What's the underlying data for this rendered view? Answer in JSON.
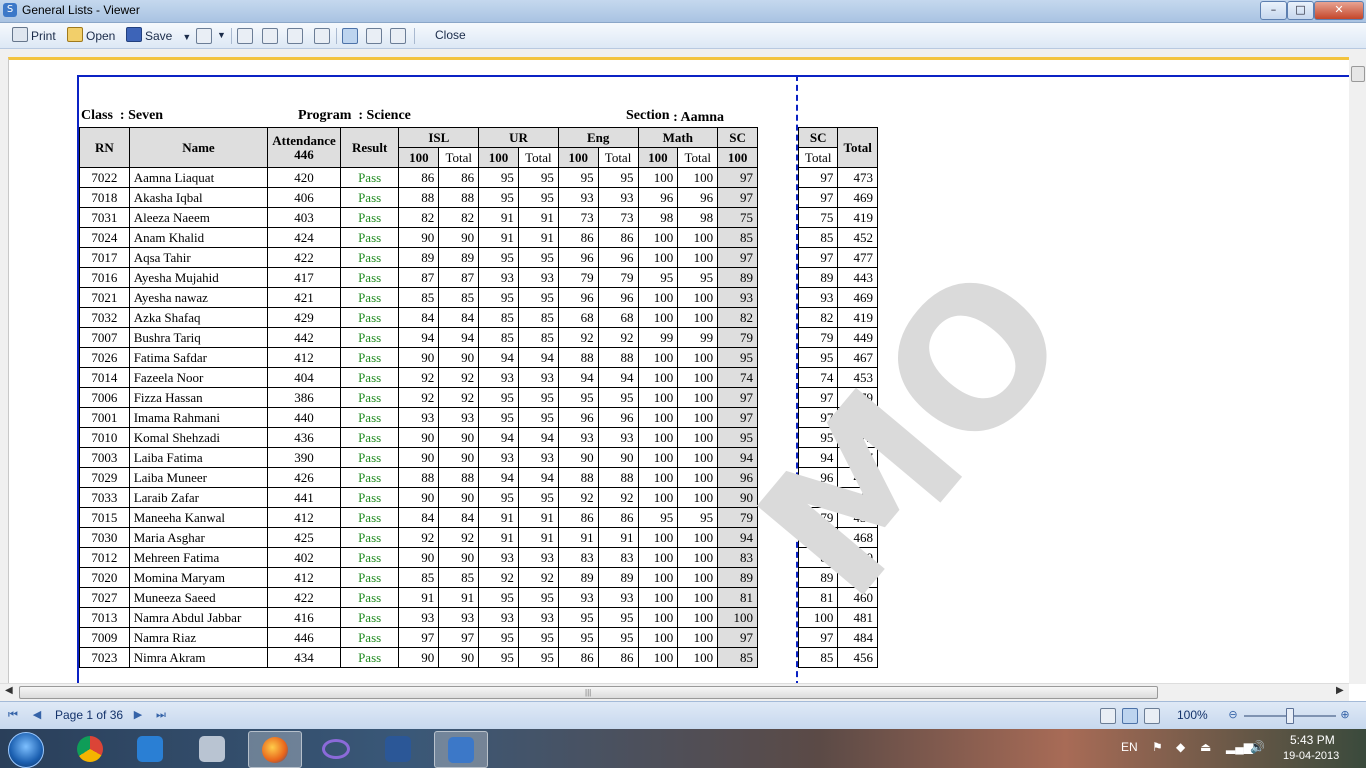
{
  "window": {
    "title": "General Lists - Viewer",
    "icon": "viewer-app-icon"
  },
  "toolbar": {
    "print_label": "Print",
    "open_label": "Open",
    "save_label": "Save",
    "close_label": "Close"
  },
  "report": {
    "class_label": "Class",
    "class_value": ": Seven",
    "program_label": "Program",
    "program_value": ": Science",
    "section_label": "Section",
    "section_value": ": Aamna",
    "headers": {
      "rn": "RN",
      "name": "Name",
      "attendance": "Attendance",
      "attendance_total": "446",
      "result": "Result",
      "isl": "ISL",
      "ur": "UR",
      "eng": "Eng",
      "math": "Math",
      "sc": "SC",
      "max": "100",
      "total": "Total",
      "sc_right": "SC",
      "sc_right_total": "Total",
      "grand_total": "Total"
    },
    "rows": [
      {
        "rn": "7022",
        "name": "Aamna Liaquat",
        "att": "420",
        "result": "Pass",
        "isl": "86",
        "isl_t": "86",
        "ur": "95",
        "ur_t": "95",
        "eng": "95",
        "eng_t": "95",
        "math": "100",
        "math_t": "100",
        "sc": "97",
        "sc_t": "97",
        "total": "473"
      },
      {
        "rn": "7018",
        "name": "Akasha Iqbal",
        "att": "406",
        "result": "Pass",
        "isl": "88",
        "isl_t": "88",
        "ur": "95",
        "ur_t": "95",
        "eng": "93",
        "eng_t": "93",
        "math": "96",
        "math_t": "96",
        "sc": "97",
        "sc_t": "97",
        "total": "469"
      },
      {
        "rn": "7031",
        "name": "Aleeza Naeem",
        "att": "403",
        "result": "Pass",
        "isl": "82",
        "isl_t": "82",
        "ur": "91",
        "ur_t": "91",
        "eng": "73",
        "eng_t": "73",
        "math": "98",
        "math_t": "98",
        "sc": "75",
        "sc_t": "75",
        "total": "419"
      },
      {
        "rn": "7024",
        "name": "Anam Khalid",
        "att": "424",
        "result": "Pass",
        "isl": "90",
        "isl_t": "90",
        "ur": "91",
        "ur_t": "91",
        "eng": "86",
        "eng_t": "86",
        "math": "100",
        "math_t": "100",
        "sc": "85",
        "sc_t": "85",
        "total": "452"
      },
      {
        "rn": "7017",
        "name": "Aqsa Tahir",
        "att": "422",
        "result": "Pass",
        "isl": "89",
        "isl_t": "89",
        "ur": "95",
        "ur_t": "95",
        "eng": "96",
        "eng_t": "96",
        "math": "100",
        "math_t": "100",
        "sc": "97",
        "sc_t": "97",
        "total": "477"
      },
      {
        "rn": "7016",
        "name": "Ayesha Mujahid",
        "att": "417",
        "result": "Pass",
        "isl": "87",
        "isl_t": "87",
        "ur": "93",
        "ur_t": "93",
        "eng": "79",
        "eng_t": "79",
        "math": "95",
        "math_t": "95",
        "sc": "89",
        "sc_t": "89",
        "total": "443"
      },
      {
        "rn": "7021",
        "name": "Ayesha nawaz",
        "att": "421",
        "result": "Pass",
        "isl": "85",
        "isl_t": "85",
        "ur": "95",
        "ur_t": "95",
        "eng": "96",
        "eng_t": "96",
        "math": "100",
        "math_t": "100",
        "sc": "93",
        "sc_t": "93",
        "total": "469"
      },
      {
        "rn": "7032",
        "name": "Azka Shafaq",
        "att": "429",
        "result": "Pass",
        "isl": "84",
        "isl_t": "84",
        "ur": "85",
        "ur_t": "85",
        "eng": "68",
        "eng_t": "68",
        "math": "100",
        "math_t": "100",
        "sc": "82",
        "sc_t": "82",
        "total": "419"
      },
      {
        "rn": "7007",
        "name": "Bushra Tariq",
        "att": "442",
        "result": "Pass",
        "isl": "94",
        "isl_t": "94",
        "ur": "85",
        "ur_t": "85",
        "eng": "92",
        "eng_t": "92",
        "math": "99",
        "math_t": "99",
        "sc": "79",
        "sc_t": "79",
        "total": "449"
      },
      {
        "rn": "7026",
        "name": "Fatima Safdar",
        "att": "412",
        "result": "Pass",
        "isl": "90",
        "isl_t": "90",
        "ur": "94",
        "ur_t": "94",
        "eng": "88",
        "eng_t": "88",
        "math": "100",
        "math_t": "100",
        "sc": "95",
        "sc_t": "95",
        "total": "467"
      },
      {
        "rn": "7014",
        "name": "Fazeela Noor",
        "att": "404",
        "result": "Pass",
        "isl": "92",
        "isl_t": "92",
        "ur": "93",
        "ur_t": "93",
        "eng": "94",
        "eng_t": "94",
        "math": "100",
        "math_t": "100",
        "sc": "74",
        "sc_t": "74",
        "total": "453"
      },
      {
        "rn": "7006",
        "name": "Fizza Hassan",
        "att": "386",
        "result": "Pass",
        "isl": "92",
        "isl_t": "92",
        "ur": "95",
        "ur_t": "95",
        "eng": "95",
        "eng_t": "95",
        "math": "100",
        "math_t": "100",
        "sc": "97",
        "sc_t": "97",
        "total": "479"
      },
      {
        "rn": "7001",
        "name": "Imama Rahmani",
        "att": "440",
        "result": "Pass",
        "isl": "93",
        "isl_t": "93",
        "ur": "95",
        "ur_t": "95",
        "eng": "96",
        "eng_t": "96",
        "math": "100",
        "math_t": "100",
        "sc": "97",
        "sc_t": "97",
        "total": "481"
      },
      {
        "rn": "7010",
        "name": "Komal Shehzadi",
        "att": "436",
        "result": "Pass",
        "isl": "90",
        "isl_t": "90",
        "ur": "94",
        "ur_t": "94",
        "eng": "93",
        "eng_t": "93",
        "math": "100",
        "math_t": "100",
        "sc": "95",
        "sc_t": "95",
        "total": "472"
      },
      {
        "rn": "7003",
        "name": "Laiba Fatima",
        "att": "390",
        "result": "Pass",
        "isl": "90",
        "isl_t": "90",
        "ur": "93",
        "ur_t": "93",
        "eng": "90",
        "eng_t": "90",
        "math": "100",
        "math_t": "100",
        "sc": "94",
        "sc_t": "94",
        "total": "467"
      },
      {
        "rn": "7029",
        "name": "Laiba Muneer",
        "att": "426",
        "result": "Pass",
        "isl": "88",
        "isl_t": "88",
        "ur": "94",
        "ur_t": "94",
        "eng": "88",
        "eng_t": "88",
        "math": "100",
        "math_t": "100",
        "sc": "96",
        "sc_t": "96",
        "total": "466"
      },
      {
        "rn": "7033",
        "name": "Laraib Zafar",
        "att": "441",
        "result": "Pass",
        "isl": "90",
        "isl_t": "90",
        "ur": "95",
        "ur_t": "95",
        "eng": "92",
        "eng_t": "92",
        "math": "100",
        "math_t": "100",
        "sc": "90",
        "sc_t": "90",
        "total": "467"
      },
      {
        "rn": "7015",
        "name": "Maneeha Kanwal",
        "att": "412",
        "result": "Pass",
        "isl": "84",
        "isl_t": "84",
        "ur": "91",
        "ur_t": "91",
        "eng": "86",
        "eng_t": "86",
        "math": "95",
        "math_t": "95",
        "sc": "79",
        "sc_t": "79",
        "total": "435"
      },
      {
        "rn": "7030",
        "name": "Maria Asghar",
        "att": "425",
        "result": "Pass",
        "isl": "92",
        "isl_t": "92",
        "ur": "91",
        "ur_t": "91",
        "eng": "91",
        "eng_t": "91",
        "math": "100",
        "math_t": "100",
        "sc": "94",
        "sc_t": "94",
        "total": "468"
      },
      {
        "rn": "7012",
        "name": "Mehreen Fatima",
        "att": "402",
        "result": "Pass",
        "isl": "90",
        "isl_t": "90",
        "ur": "93",
        "ur_t": "93",
        "eng": "83",
        "eng_t": "83",
        "math": "100",
        "math_t": "100",
        "sc": "83",
        "sc_t": "83",
        "total": "449"
      },
      {
        "rn": "7020",
        "name": "Momina Maryam",
        "att": "412",
        "result": "Pass",
        "isl": "85",
        "isl_t": "85",
        "ur": "92",
        "ur_t": "92",
        "eng": "89",
        "eng_t": "89",
        "math": "100",
        "math_t": "100",
        "sc": "89",
        "sc_t": "89",
        "total": "455"
      },
      {
        "rn": "7027",
        "name": "Muneeza Saeed",
        "att": "422",
        "result": "Pass",
        "isl": "91",
        "isl_t": "91",
        "ur": "95",
        "ur_t": "95",
        "eng": "93",
        "eng_t": "93",
        "math": "100",
        "math_t": "100",
        "sc": "81",
        "sc_t": "81",
        "total": "460"
      },
      {
        "rn": "7013",
        "name": "Namra Abdul Jabbar",
        "att": "416",
        "result": "Pass",
        "isl": "93",
        "isl_t": "93",
        "ur": "93",
        "ur_t": "93",
        "eng": "95",
        "eng_t": "95",
        "math": "100",
        "math_t": "100",
        "sc": "100",
        "sc_t": "100",
        "total": "481"
      },
      {
        "rn": "7009",
        "name": "Namra Riaz",
        "att": "446",
        "result": "Pass",
        "isl": "97",
        "isl_t": "97",
        "ur": "95",
        "ur_t": "95",
        "eng": "95",
        "eng_t": "95",
        "math": "100",
        "math_t": "100",
        "sc": "97",
        "sc_t": "97",
        "total": "484"
      },
      {
        "rn": "7023",
        "name": "Nimra Akram",
        "att": "434",
        "result": "Pass",
        "isl": "90",
        "isl_t": "90",
        "ur": "95",
        "ur_t": "95",
        "eng": "86",
        "eng_t": "86",
        "math": "100",
        "math_t": "100",
        "sc": "85",
        "sc_t": "85",
        "total": "456"
      }
    ],
    "watermark": "MO"
  },
  "statusbar": {
    "page_label": "Page 1 of 36",
    "zoom_label": "100%",
    "zoom_level_percent": 100
  },
  "taskbar": {
    "apps": [
      "start-button",
      "chrome-icon",
      "teamviewer-icon",
      "calculator-icon",
      "firefox-icon",
      "infinity-app-icon",
      "word-icon",
      "viewer-app-icon"
    ],
    "language": "EN",
    "time": "5:43 PM",
    "date": "19-04-2013"
  },
  "colors": {
    "frame": "#0b22c4",
    "pass": "#1f8a1f",
    "header_bg": "#dedede"
  }
}
